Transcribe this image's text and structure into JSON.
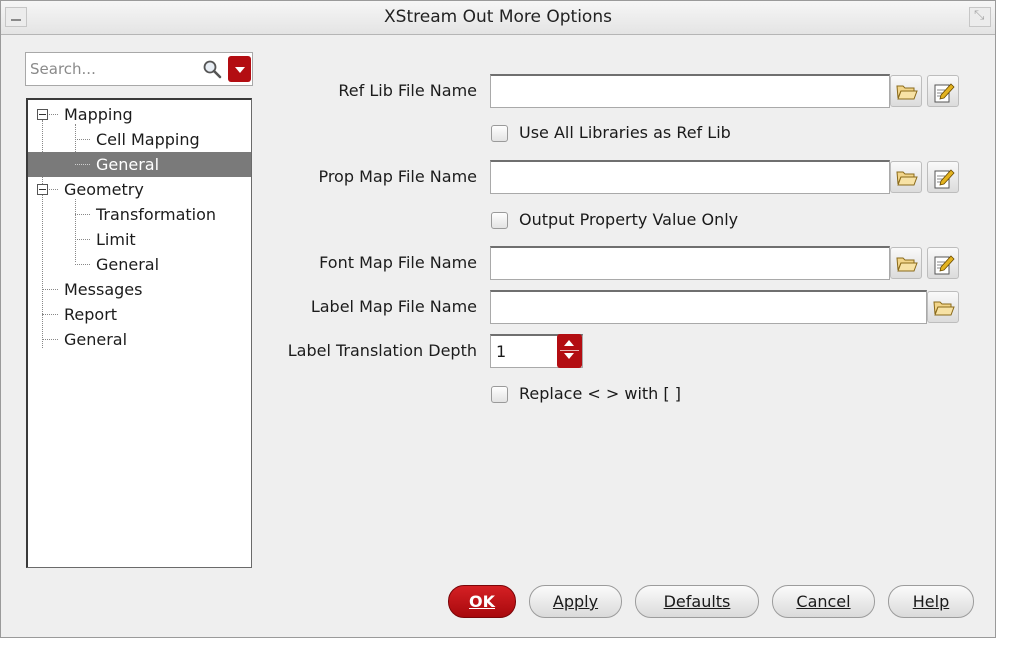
{
  "window": {
    "title": "XStream Out More Options"
  },
  "search": {
    "placeholder": "Search..."
  },
  "tree": {
    "mapping": "Mapping",
    "cell_mapping": "Cell Mapping",
    "mapping_general": "General",
    "geometry": "Geometry",
    "transformation": "Transformation",
    "limit": "Limit",
    "geometry_general": "General",
    "messages": "Messages",
    "report": "Report",
    "general": "General",
    "selected": "General (Mapping)"
  },
  "form": {
    "ref_lib_label": "Ref Lib File Name",
    "ref_lib_value": "",
    "use_all_libs_label": "Use All Libraries as Ref Lib",
    "use_all_libs_checked": false,
    "prop_map_label": "Prop Map File Name",
    "prop_map_value": "",
    "output_prop_label": "Output Property Value Only",
    "output_prop_checked": false,
    "font_map_label": "Font Map File Name",
    "font_map_value": "",
    "label_map_label": "Label Map File Name",
    "label_map_value": "",
    "label_depth_label": "Label Translation Depth",
    "label_depth_value": "1",
    "replace_label": "Replace < > with [ ]",
    "replace_checked": false
  },
  "buttons": {
    "ok": "OK",
    "apply": "Apply",
    "defaults": "Defaults",
    "cancel": "Cancel",
    "help": "Help"
  },
  "icons": {
    "browse": "folder-open-icon",
    "edit": "edit-notepad-icon",
    "search": "magnifier-icon"
  },
  "colors": {
    "accent": "#b30d12",
    "selection": "#7a7a7a"
  }
}
